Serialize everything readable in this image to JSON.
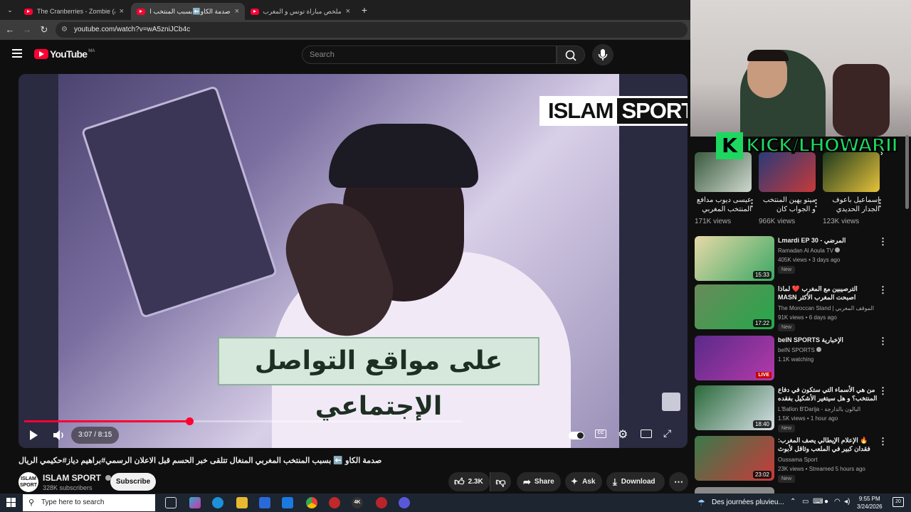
{
  "tabs": [
    {
      "title": "The Cranberries - Zombie (Alt. V",
      "close": "×"
    },
    {
      "title": "صدمة الكاو⬅️بسبب المنتخب الم",
      "close": "×"
    },
    {
      "title": "ملخص مباراة تونس و المغرب be",
      "close": "×"
    }
  ],
  "new_tab": "+",
  "address": "youtube.com/watch?v=wA5zniJCb4c",
  "header": {
    "logo_text": "YouTube",
    "region": "MA",
    "search_placeholder": "Search"
  },
  "video": {
    "watermark_islam": "ISLAM",
    "watermark_sport": "SPORT",
    "caption": "على مواقع التواصل الإجتماعي",
    "time": "3:07 / 8:15",
    "progress": 0.377,
    "title": "صدمة الكاو ⬅️ بسبب المنتخب المغربي المنغال تتلقى خبر الحسم قبل الاعلان الرسمي#براهيم دياز#حكيمي الريال"
  },
  "channel": {
    "avatar_text": "ISLAM SPORT",
    "name": "ISLAM SPORT",
    "subscribers": "328K subscribers",
    "subscribe_label": "Subscribe"
  },
  "actions": {
    "likes": "2.3K",
    "share": "Share",
    "ask": "Ask",
    "download": "Download"
  },
  "stream_overlay": "KICK/LHOWARII",
  "shorts": [
    {
      "title": "عيسى ديوب مدافع المنتخب المغربي",
      "views": "171K views"
    },
    {
      "title": "ميتو يهين المنتخب و الجواب كان",
      "views": "966K views"
    },
    {
      "title": "إسماعيل باعوف الجدار الحديدي",
      "views": "123K views"
    }
  ],
  "recommendations": [
    {
      "title": "Lmardi  EP 30 - المرضي",
      "channel": "Ramadan Al Aoula TV",
      "meta": "405K views • 3 days ago",
      "badge": "New",
      "duration": "15:33"
    },
    {
      "title": "الترصيبين مع المغرب ❤️ لماذا اصبحت المغرب الأكثر MASN",
      "channel": "The Moroccan Stand | الموقف المغربي",
      "meta": "91K views • 6 days ago",
      "badge": "New",
      "duration": "17:22"
    },
    {
      "title": "beIN SPORTS الإخبارية",
      "channel": "beIN SPORTS",
      "meta": "1.1K watching",
      "badge": "",
      "duration": "LIVE"
    },
    {
      "title": "من هي الأسماء التي ستكون في دفاع المنتخب؟ و هل سيتغير الأشكيل بفقده وهبي؟",
      "channel": "L'Ballon B'Darija - البالون بالدارجة",
      "meta": "1.5K views • 1 hour ago",
      "badge": "New",
      "duration": "18:40"
    },
    {
      "title": "🔥 الإعلام الإيطالي يصف المغرب: فقدان كبير في الملعب وثاقل لأبوث لإبراهيم دياز",
      "channel": "Oussama Sport",
      "meta": "23K views • Streamed 5 hours ago",
      "badge": "New",
      "duration": "23:02"
    }
  ],
  "taskbar": {
    "search_placeholder": "Type here to search",
    "weather": "Des journées pluvieu...",
    "time": "9:55 PM",
    "date": "3/24/2026",
    "notifications": "20"
  }
}
